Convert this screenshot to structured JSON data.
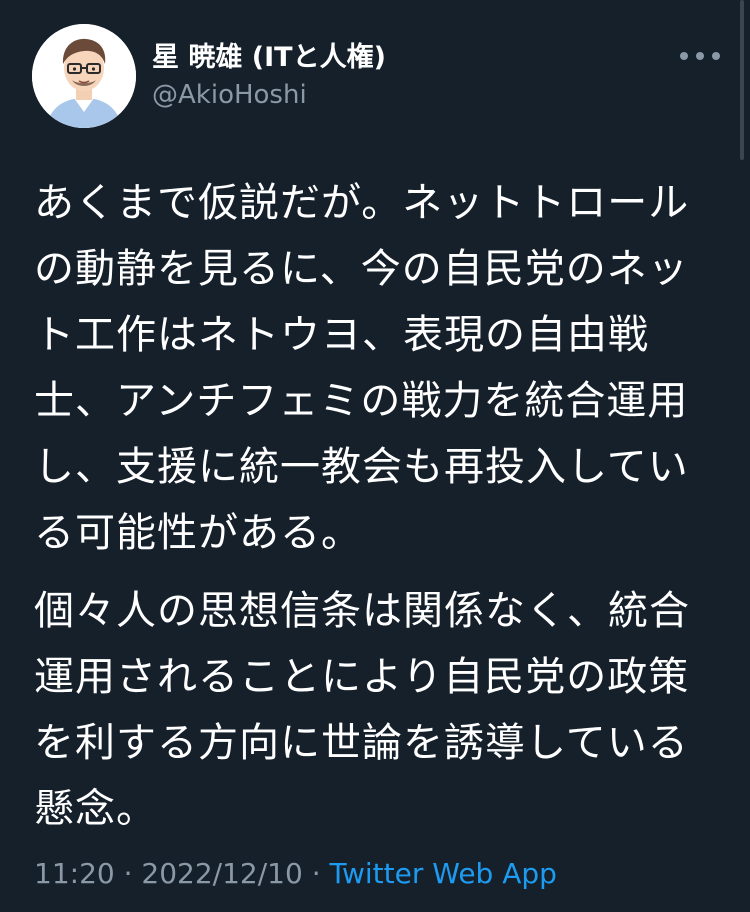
{
  "user": {
    "display_name": "星 暁雄 (ITと人権)",
    "handle": "@AkioHoshi"
  },
  "tweet": {
    "paragraphs": [
      "あくまで仮説だが。ネットトロール\nの動静を見るに、今の自民党のネッ\nト工作はネトウヨ、表現の自由戦\n士、アンチフェミの戦力を統合運用\nし、支援に統一教会も再投入してい\nる可能性がある。",
      "個々人の思想信条は関係なく、統合\n運用されることにより自民党の政策\nを利する方向に世論を誘導している\n懸念。"
    ],
    "time": "11:20",
    "separator": "·",
    "date": "2022/12/10",
    "source": "Twitter Web App"
  },
  "icons": {
    "more": "more-horizontal-icon",
    "avatar": "avatar-illustration"
  },
  "colors": {
    "background": "#15202b",
    "text": "#ffffff",
    "secondary": "#8b98a5",
    "link": "#1d9bf0"
  }
}
